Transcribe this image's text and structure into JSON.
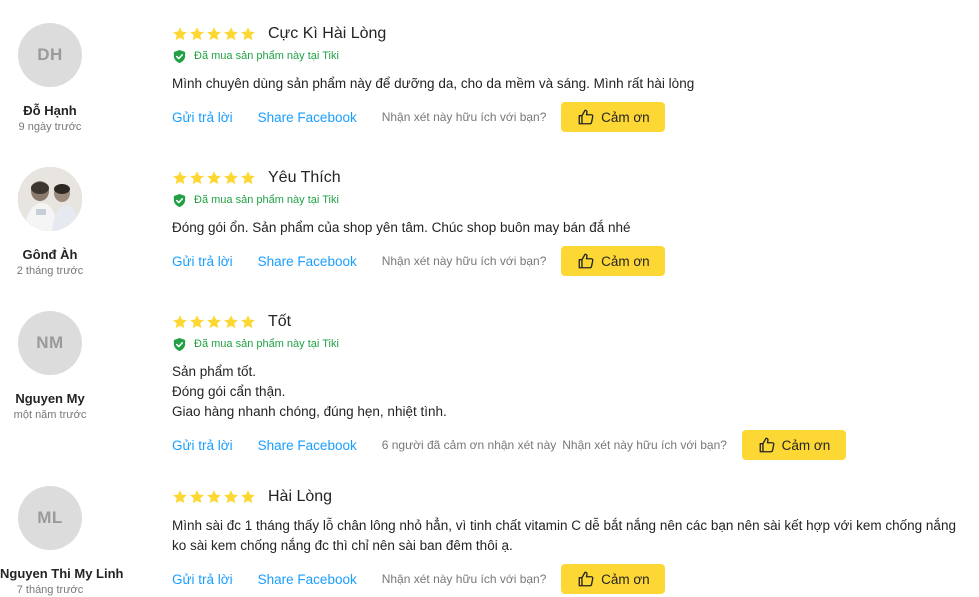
{
  "reviews": [
    {
      "initials": "DH",
      "name": "Đỗ Hạnh",
      "time": "9 ngày trước",
      "rating": 5,
      "title": "Cực Kì Hài Lòng",
      "verified": "Đã mua sản phẩm này tại Tiki",
      "lines": [
        "Mình chuyên dùng sản phẩm này để dưỡng da, cho da mềm và sáng. Mình rất hài lòng"
      ],
      "reply_label": "Gửi trả lời",
      "share_label": "Share Facebook",
      "thanks_count": "",
      "helpful_label": "Nhận xét này hữu ích với bạn?",
      "thanks_label": "Cảm ơn"
    },
    {
      "initials": "",
      "name": "Gônđ Àh",
      "time": "2 tháng trước",
      "rating": 5,
      "title": "Yêu Thích",
      "verified": "Đã mua sản phẩm này tại Tiki",
      "lines": [
        "Đóng gói ổn. Sản phẩm của shop yên tâm. Chúc shop buôn may bán đắ nhé"
      ],
      "reply_label": "Gửi trả lời",
      "share_label": "Share Facebook",
      "thanks_count": "",
      "helpful_label": "Nhận xét này hữu ích với bạn?",
      "thanks_label": "Cảm ơn"
    },
    {
      "initials": "NM",
      "name": "Nguyen My",
      "time": "một năm trước",
      "rating": 5,
      "title": "Tốt",
      "verified": "Đã mua sản phẩm này tại Tiki",
      "lines": [
        "Sản phẩm tốt.",
        "Đóng gói cẩn thận.",
        "Giao hàng nhanh chóng, đúng hẹn, nhiệt tình."
      ],
      "reply_label": "Gửi trả lời",
      "share_label": "Share Facebook",
      "thanks_count": "6 người đã cảm ơn nhận xét này",
      "helpful_label": "Nhận xét này hữu ích với bạn?",
      "thanks_label": "Cảm ơn"
    },
    {
      "initials": "ML",
      "name": "Nguyen Thi My Linh",
      "time": "7 tháng trước",
      "rating": 5,
      "title": "Hài Lòng",
      "verified": "",
      "lines": [
        "Mình sài đc 1 tháng thấy lỗ chân lông nhỏ hẳn, vì tinh chất vitamin C dễ bắt nắng nên các bạn nên sài kết hợp với kem chống nắng",
        "ko sài kem chống nắng đc thì chỉ nên sài ban đêm thôi ạ."
      ],
      "reply_label": "Gửi trả lời",
      "share_label": "Share Facebook",
      "thanks_count": "",
      "helpful_label": "Nhận xét này hữu ích với bạn?",
      "thanks_label": "Cảm ơn"
    }
  ],
  "icons": {
    "star": "star-icon",
    "verified": "shield-check-icon",
    "thanks": "thumbs-up-icon"
  },
  "colors": {
    "star": "#fdd835",
    "verified": "#22a046",
    "link": "#189eff",
    "button": "#fdd835",
    "avatar_bg": "#dcdcdc"
  }
}
